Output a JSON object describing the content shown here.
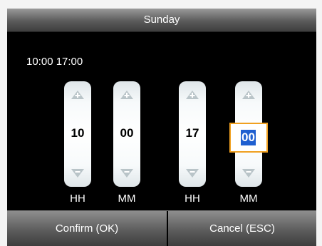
{
  "window": {
    "title": "Sunday"
  },
  "time_range": "10:00  17:00",
  "spinners": [
    {
      "value": "10",
      "unit": "HH"
    },
    {
      "value": "00",
      "unit": "MM"
    },
    {
      "value": "17",
      "unit": "HH"
    },
    {
      "value": "00",
      "unit": "MM"
    }
  ],
  "buttons": {
    "confirm": "Confirm (OK)",
    "cancel": "Cancel (ESC)"
  },
  "colors": {
    "focus_border": "#f0a020",
    "selection": "#1f5fd0"
  },
  "icons": {
    "up": "triangle-up-icon",
    "down": "triangle-down-icon"
  }
}
